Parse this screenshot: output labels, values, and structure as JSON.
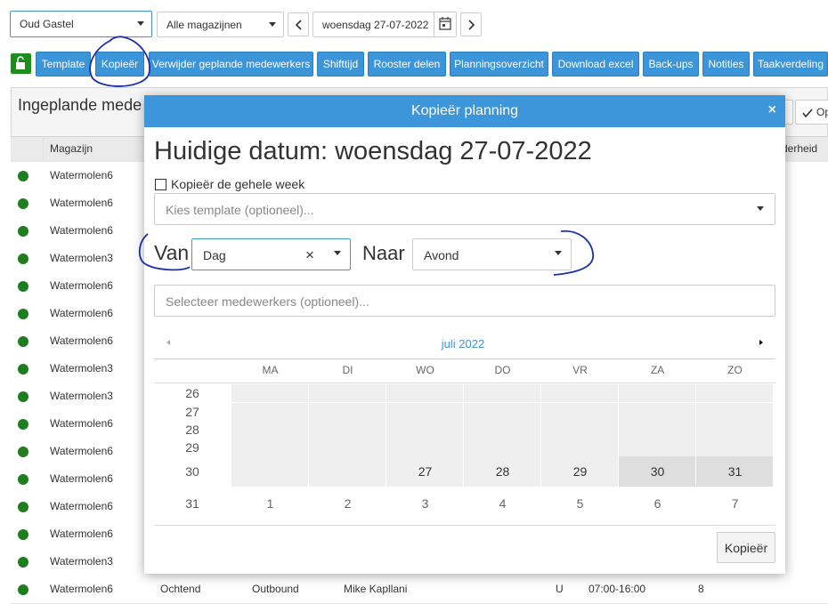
{
  "top": {
    "location_select": "Oud Gastel",
    "warehouse_select": "Alle magazijnen",
    "date_value": "woensdag 27-07-2022",
    "prev_icon": "chevron-left-icon",
    "next_icon": "chevron-right-icon"
  },
  "toolbar": {
    "buttons": [
      "Template",
      "Kopieër",
      "Verwijder geplande medewerkers",
      "Shifttijd",
      "Rooster delen",
      "Planningsoverzicht",
      "Download excel",
      "Back-ups",
      "Notities",
      "Taakverdeling"
    ]
  },
  "panel": {
    "title": "Ingeplande mede",
    "ok_button": "Op",
    "col_magazijn": "Magazijn",
    "col_right": "derheid"
  },
  "rows": [
    {
      "magazijn": "Watermolen6"
    },
    {
      "magazijn": "Watermolen6"
    },
    {
      "magazijn": "Watermolen6"
    },
    {
      "magazijn": "Watermolen3"
    },
    {
      "magazijn": "Watermolen6"
    },
    {
      "magazijn": "Watermolen6"
    },
    {
      "magazijn": "Watermolen6"
    },
    {
      "magazijn": "Watermolen3"
    },
    {
      "magazijn": "Watermolen3"
    },
    {
      "magazijn": "Watermolen6"
    },
    {
      "magazijn": "Watermolen6"
    },
    {
      "magazijn": "Watermolen6"
    },
    {
      "magazijn": "Watermolen6"
    },
    {
      "magazijn": "Watermolen6"
    },
    {
      "magazijn": "Watermolen3"
    }
  ],
  "last_row": {
    "magazijn": "Watermolen6",
    "shift": "Ochtend",
    "afdeling": "Outbound",
    "naam": "Mike Kapllani",
    "code": "U",
    "tijd": "07:00-16:00",
    "uren": "8"
  },
  "modal": {
    "title": "Kopieër planning",
    "close": "×",
    "heading": "Huidige datum: woensdag 27-07-2022",
    "week_checkbox_label": "Kopieër de gehele week",
    "template_placeholder": "Kies template (optioneel)...",
    "van_label": "Van",
    "van_value": "Dag",
    "naar_label": "Naar",
    "naar_value": "Avond",
    "employees_placeholder": "Selecteer medewerkers (optioneel)...",
    "copy_button": "Kopieër"
  },
  "calendar": {
    "month": "juli 2022",
    "weekdays": [
      "MA",
      "DI",
      "WO",
      "DO",
      "VR",
      "ZA",
      "ZO"
    ],
    "weeks": [
      {
        "num": "26",
        "days": [
          "",
          "",
          "",
          "",
          "",
          "",
          ""
        ]
      },
      {
        "num": "27",
        "days": [
          "",
          "",
          "",
          "",
          "",
          "",
          ""
        ]
      },
      {
        "num": "28",
        "days": [
          "",
          "",
          "",
          "",
          "",
          "",
          ""
        ]
      },
      {
        "num": "29",
        "days": [
          "",
          "",
          "",
          "",
          "",
          "",
          ""
        ]
      },
      {
        "num": "30",
        "days": [
          "",
          "",
          "27",
          "28",
          "29",
          "30",
          "31"
        ]
      },
      {
        "num": "31",
        "days": [
          "1",
          "2",
          "3",
          "4",
          "5",
          "6",
          "7"
        ]
      }
    ]
  }
}
